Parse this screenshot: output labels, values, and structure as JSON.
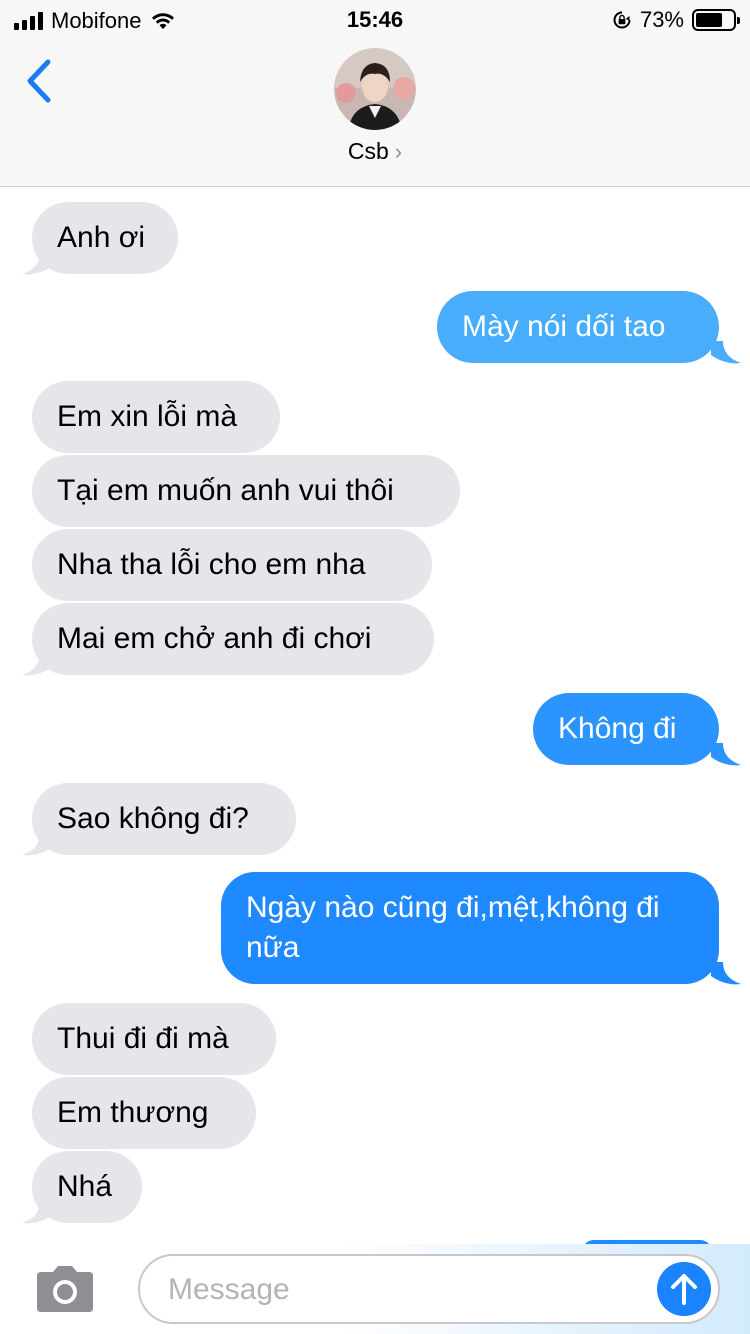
{
  "status_bar": {
    "carrier": "Mobifone",
    "time": "15:46",
    "battery": "73%",
    "battery_level": 0.73
  },
  "header": {
    "contact_name": "Csb",
    "chevron": "›"
  },
  "messages": [
    {
      "direction": "in",
      "text": "Anh ơi"
    },
    {
      "direction": "out",
      "text": "Mày nói dối tao"
    },
    {
      "direction": "in",
      "text": "Em xin lỗi mà"
    },
    {
      "direction": "in",
      "text": "Tại em muốn anh vui thôi"
    },
    {
      "direction": "in",
      "text": "Nha tha lỗi cho em nha"
    },
    {
      "direction": "in",
      "text": "Mai em chở anh đi chơi"
    },
    {
      "direction": "out",
      "text": "Không đi"
    },
    {
      "direction": "in",
      "text": "Sao không đi?"
    },
    {
      "direction": "out",
      "text": "Ngày nào cũng đi,mệt,không đi nữa"
    },
    {
      "direction": "in",
      "text": "Thui đi đi mà"
    },
    {
      "direction": "in",
      "text": "Em thương"
    },
    {
      "direction": "in",
      "text": "Nhá"
    }
  ],
  "composer": {
    "placeholder": "Message"
  },
  "colors": {
    "incoming": "#e5e5ea",
    "outgoing_top": "#4bb0fb",
    "outgoing_bottom": "#1a84ff",
    "accent": "#1a84ff"
  },
  "icons": {
    "back": "chevron-left-icon",
    "camera": "camera-icon",
    "send": "arrow-up-icon"
  }
}
